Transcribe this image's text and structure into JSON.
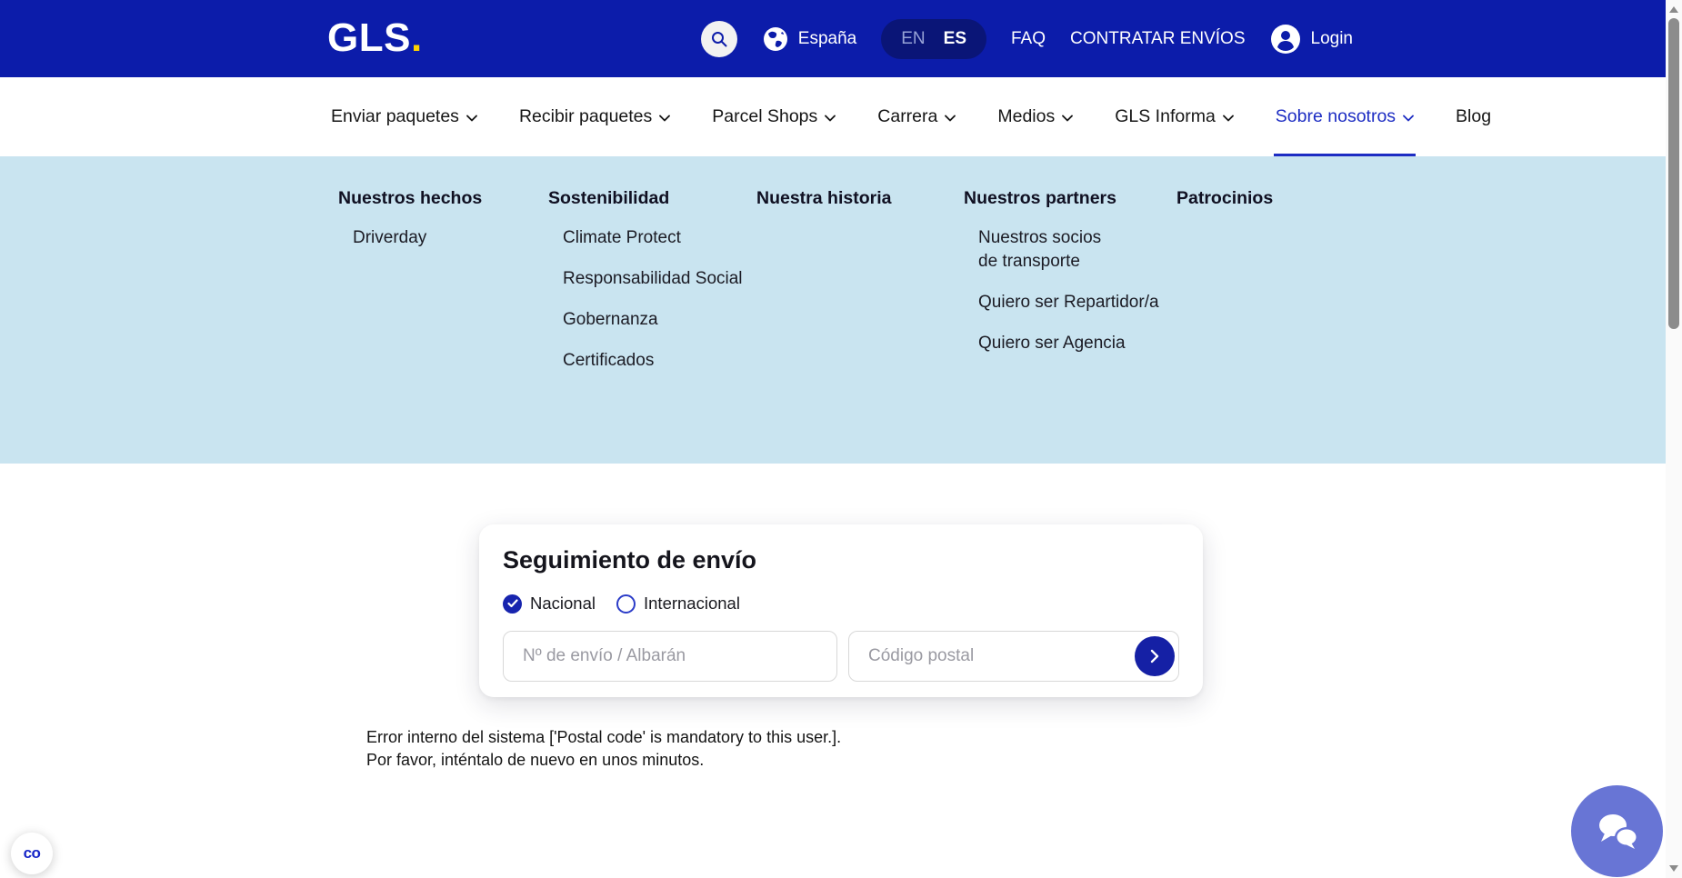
{
  "header": {
    "logo": "GLS",
    "logo_dot": ".",
    "country": "España",
    "lang": {
      "en": "EN",
      "es": "ES"
    },
    "faq": "FAQ",
    "contract": "CONTRATAR ENVÍOS",
    "login": "Login"
  },
  "nav": {
    "items": [
      {
        "label": "Enviar paquetes"
      },
      {
        "label": "Recibir paquetes"
      },
      {
        "label": "Parcel Shops"
      },
      {
        "label": "Carrera"
      },
      {
        "label": "Medios"
      },
      {
        "label": "GLS Informa"
      },
      {
        "label": "Sobre nosotros",
        "active": true
      },
      {
        "label": "Blog"
      }
    ]
  },
  "megamenu": {
    "columns": [
      {
        "title": "Nuestros hechos",
        "items": [
          "Driverday"
        ]
      },
      {
        "title": "Sostenibilidad",
        "items": [
          "Climate Protect",
          "Responsabilidad Social",
          "Gobernanza",
          "Certificados"
        ]
      },
      {
        "title": "Nuestra historia",
        "items": []
      },
      {
        "title": "Nuestros partners",
        "items": [
          "Nuestros socios de transporte",
          "Quiero ser Repartidor/a",
          "Quiero ser Agencia"
        ]
      },
      {
        "title": "Patrocinios",
        "items": []
      }
    ]
  },
  "tracking": {
    "title": "Seguimiento de envío",
    "options": {
      "national": "Nacional",
      "international": "Internacional"
    },
    "inputs": {
      "shipment_placeholder": "Nº de envío / Albarán",
      "postal_placeholder": "Código postal"
    }
  },
  "error": {
    "line1": "Error interno del sistema ['Postal code' is mandatory to this user.].",
    "line2": "Por favor, inténtalo de nuevo en unos minutos."
  },
  "icons": {
    "assist_glyph": "co"
  },
  "colors": {
    "header_blue": "#0c1caa",
    "accent_blue": "#1d2dc3",
    "megamenu_bg": "#c9e4f0",
    "logo_dot_yellow": "#ffd200",
    "chat_purple": "#6875d5",
    "radio_blue": "#1724ae"
  }
}
